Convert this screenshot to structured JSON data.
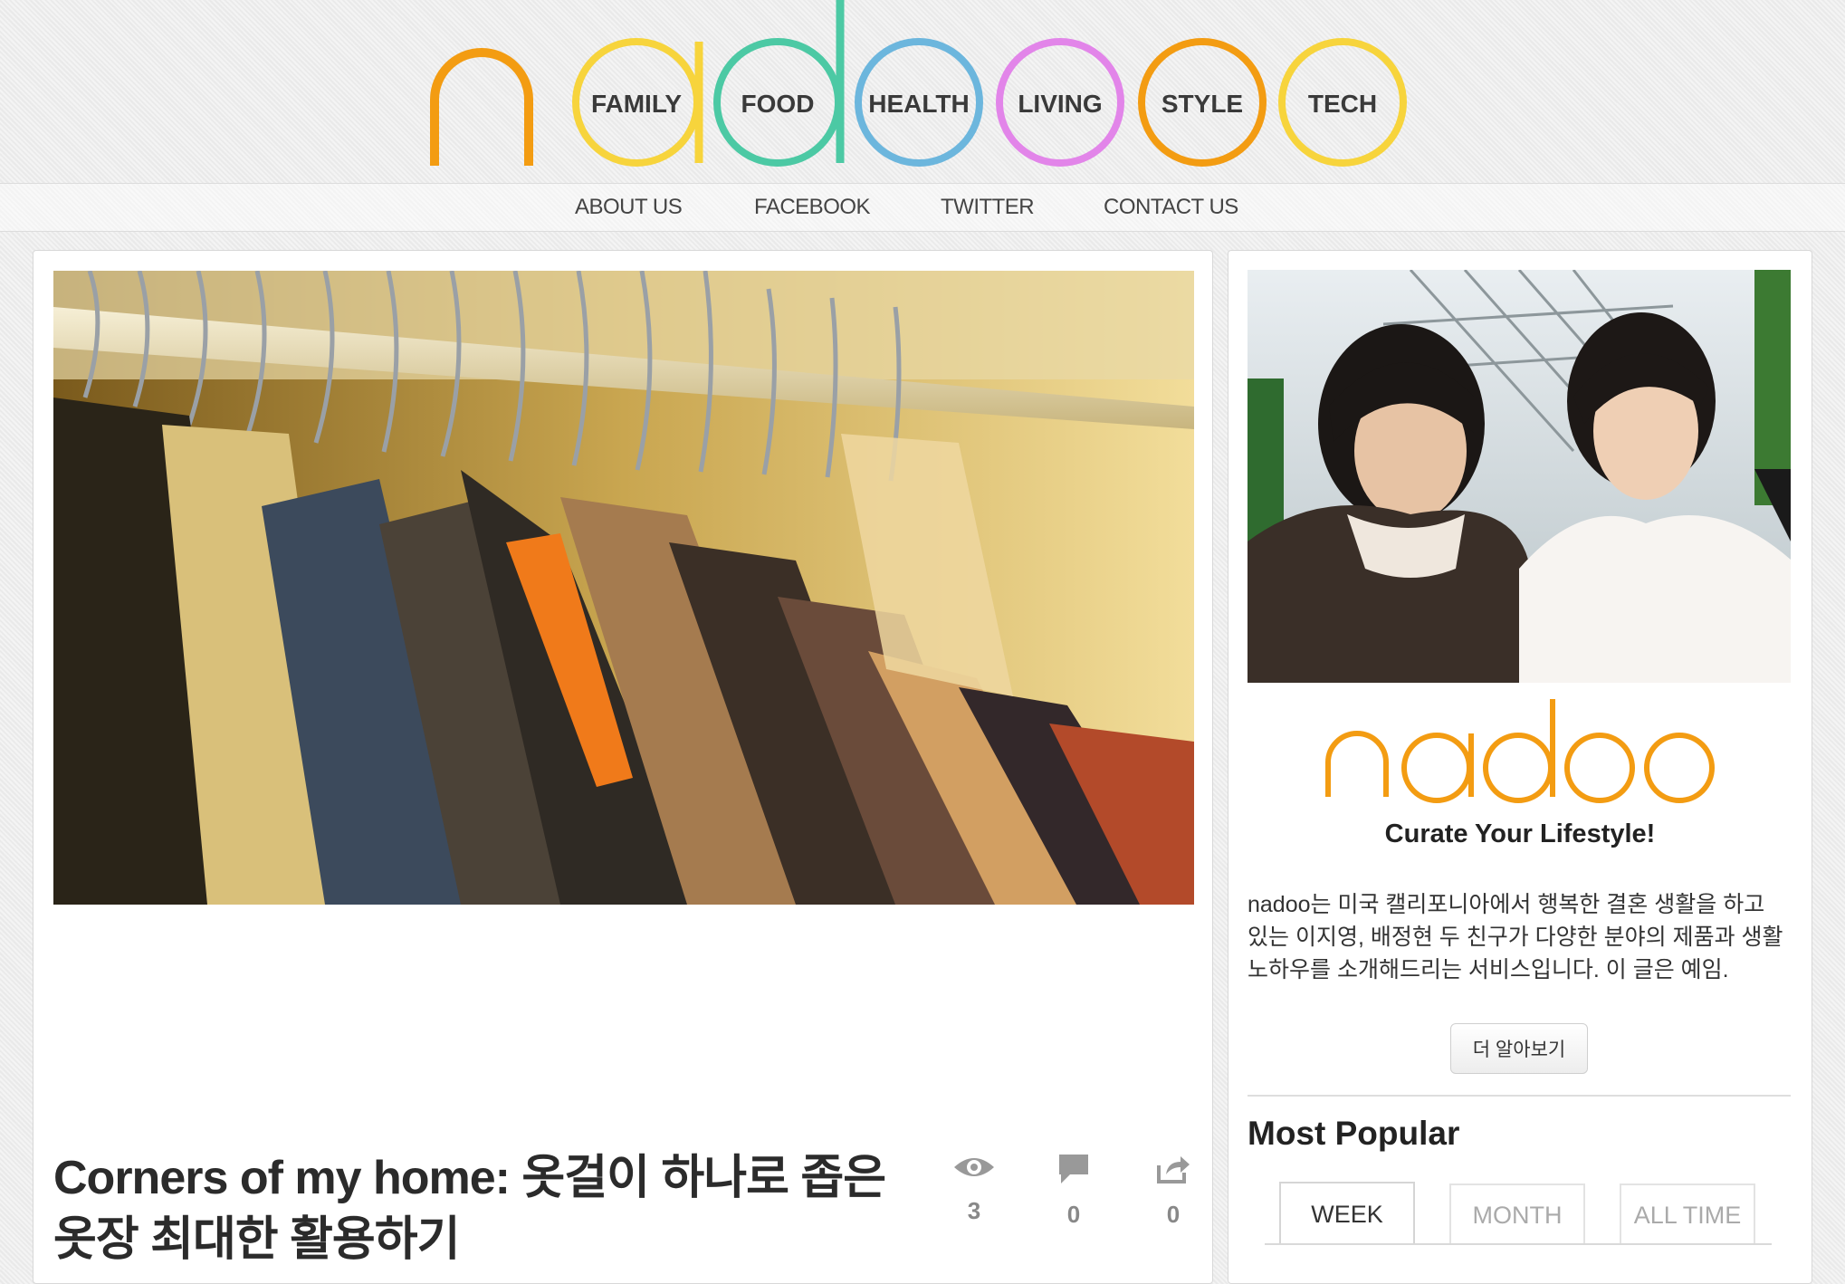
{
  "site": {
    "name": "nadoo",
    "brand_color": "#F39C12"
  },
  "categories": [
    {
      "label": "FAMILY",
      "color": "#F7D43C"
    },
    {
      "label": "FOOD",
      "color": "#4CC9A4"
    },
    {
      "label": "HEALTH",
      "color": "#6CB6DD"
    },
    {
      "label": "LIVING",
      "color": "#E285E9"
    },
    {
      "label": "STYLE",
      "color": "#F39C12"
    },
    {
      "label": "TECH",
      "color": "#F7D43C"
    }
  ],
  "nav": {
    "items": [
      "ABOUT US",
      "FACEBOOK",
      "TWITTER",
      "CONTACT US"
    ]
  },
  "post": {
    "title": "Corners of my home: 옷걸이 하나로 좁은 옷장 최대한 활용하기",
    "views": "3",
    "comments": "0",
    "shares": "0"
  },
  "sidebar": {
    "logo_text": "nadoo",
    "tagline": "Curate Your Lifestyle!",
    "description": "nadoo는 미국 캘리포니아에서 행복한 결혼 생활을 하고 있는 이지영, 배정현 두 친구가 다양한 분야의 제품과 생활 노하우를 소개해드리는 서비스입니다. 이 글은 예임.",
    "more_button": "더 알아보기",
    "popular_title": "Most Popular",
    "tabs": [
      "WEEK",
      "MONTH",
      "ALL TIME"
    ],
    "active_tab": "WEEK"
  }
}
